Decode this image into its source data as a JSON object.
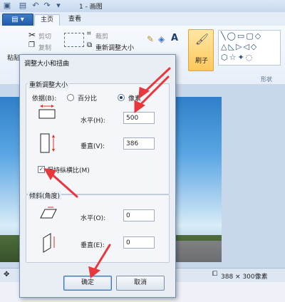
{
  "app": {
    "window_title": "1 - 画图"
  },
  "tabs": {
    "file_label": "▤ ▾",
    "home": "主页",
    "view": "查看"
  },
  "ribbon": {
    "paste": "粘贴",
    "cut": "剪切",
    "copy": "复制",
    "crop": "裁剪",
    "resize": "重新调整大小",
    "brush": "刷子",
    "shapes_group": "形状"
  },
  "status": {
    "size": "388 × 300像素"
  },
  "dialog": {
    "title": "调整大小和扭曲",
    "resize_section": "重新调整大小",
    "basis_label": "依据(B):",
    "option_percent": "百分比",
    "option_pixels": "像素",
    "selected_basis": "像素",
    "horizontal_label": "水平(H):",
    "horizontal_value": "500",
    "vertical_label": "垂直(V):",
    "vertical_value": "386",
    "keep_ratio_label": "保持纵横比(M)",
    "keep_ratio_checked": true,
    "skew_section": "倾斜(角度)",
    "skew_horizontal_label": "水平(O):",
    "skew_horizontal_value": "0",
    "skew_vertical_label": "垂直(E):",
    "skew_vertical_value": "0",
    "ok": "确定",
    "cancel": "取消"
  },
  "colors": {
    "annotation_arrow": "#e8373d",
    "dialog_border": "#7390b8"
  }
}
